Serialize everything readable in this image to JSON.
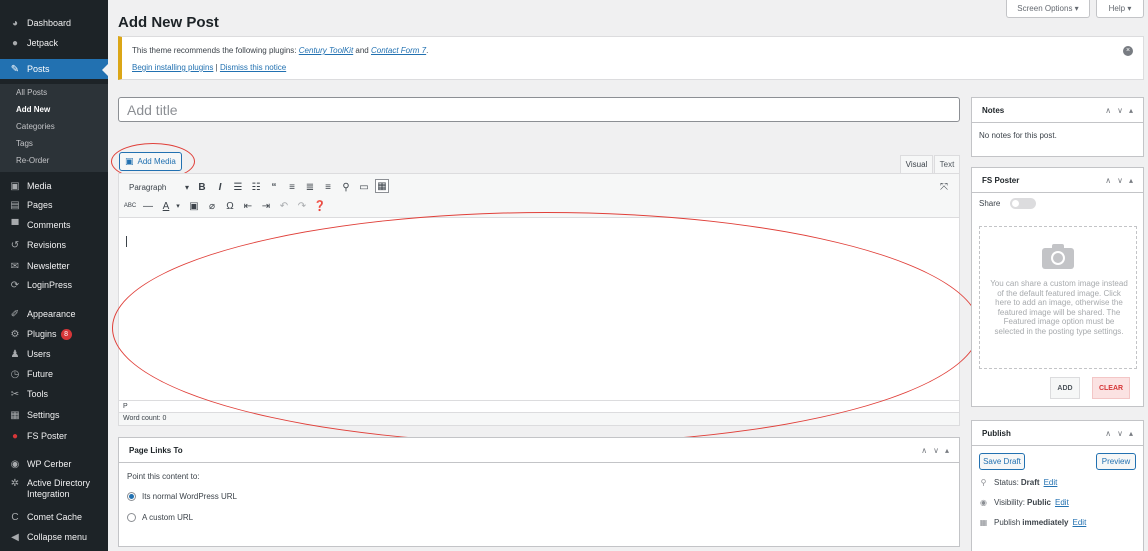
{
  "sidebar": {
    "items": [
      {
        "label": "Dashboard",
        "icon": "dashboard-icon",
        "glyph": "◕"
      },
      {
        "label": "Jetpack",
        "icon": "jetpack-icon",
        "glyph": "●"
      },
      {
        "label": "Posts",
        "icon": "pin-icon",
        "glyph": "✎"
      },
      {
        "label": "Media",
        "icon": "media-icon",
        "glyph": "▣"
      },
      {
        "label": "Pages",
        "icon": "pages-icon",
        "glyph": "▤"
      },
      {
        "label": "Comments",
        "icon": "comments-icon",
        "glyph": "▀"
      },
      {
        "label": "Revisions",
        "icon": "revisions-icon",
        "glyph": "↺"
      },
      {
        "label": "Newsletter",
        "icon": "newsletter-icon",
        "glyph": "✉"
      },
      {
        "label": "LoginPress",
        "icon": "loginpress-icon",
        "glyph": "⟳"
      },
      {
        "label": "Appearance",
        "icon": "appearance-icon",
        "glyph": "✐"
      },
      {
        "label": "Plugins",
        "icon": "plugins-icon",
        "glyph": "⚙",
        "badge": "8"
      },
      {
        "label": "Users",
        "icon": "users-icon",
        "glyph": "♟"
      },
      {
        "label": "Future",
        "icon": "clock-icon",
        "glyph": "◷"
      },
      {
        "label": "Tools",
        "icon": "tools-icon",
        "glyph": "✂"
      },
      {
        "label": "Settings",
        "icon": "settings-icon",
        "glyph": "▦"
      },
      {
        "label": "FS Poster",
        "icon": "fs-poster-icon",
        "glyph": "●"
      },
      {
        "label": "WP Cerber",
        "icon": "cerber-icon",
        "glyph": "◉"
      },
      {
        "label": "Active Directory Integration",
        "icon": "gear-icon",
        "glyph": "✲"
      },
      {
        "label": "Comet Cache",
        "icon": "comet-cache-icon",
        "glyph": "C"
      },
      {
        "label": "Collapse menu",
        "icon": "collapse-icon",
        "glyph": "◀"
      }
    ],
    "submenu": [
      "All Posts",
      "Add New",
      "Categories",
      "Tags",
      "Re-Order"
    ]
  },
  "top": {
    "screen_options": "Screen Options ▾",
    "help": "Help ▾"
  },
  "page_title": "Add New Post",
  "notice": {
    "text_before": "This theme recommends the following plugins:",
    "plugin1": "Century ToolKit",
    "and": "and",
    "plugin2": "Contact Form 7",
    "period": ".",
    "begin_link": "Begin installing plugins",
    "sep": "|",
    "dismiss_link": "Dismiss this notice"
  },
  "title_placeholder": "Add title",
  "add_media": "Add Media",
  "editor": {
    "tab_visual": "Visual",
    "tab_text": "Text",
    "format": "Paragraph",
    "path": "P",
    "word_count": "Word count: 0"
  },
  "page_links": {
    "title": "Page Links To",
    "prompt": "Point this content to:",
    "option1": "Its normal WordPress URL",
    "option2": "A custom URL"
  },
  "notes": {
    "title": "Notes",
    "body": "No notes for this post."
  },
  "fs_poster": {
    "title": "FS Poster",
    "share": "Share",
    "dropzone": "You can share a custom image instead of the default featured image. Click here to add an image, otherwise the featured image will be shared. The Featured image option must be selected in the posting type settings.",
    "add": "ADD",
    "clear": "CLEAR"
  },
  "publish": {
    "title": "Publish",
    "save_draft": "Save Draft",
    "preview": "Preview",
    "status_label": "Status:",
    "status_value": "Draft",
    "visibility_label": "Visibility:",
    "visibility_value": "Public",
    "publish_label": "Publish",
    "publish_value": "immediately",
    "edit": "Edit"
  },
  "colors": {
    "accent": "#2271b1",
    "sidebar": "#1d2327",
    "notice": "#dba617",
    "annotation": "#e0403a"
  }
}
